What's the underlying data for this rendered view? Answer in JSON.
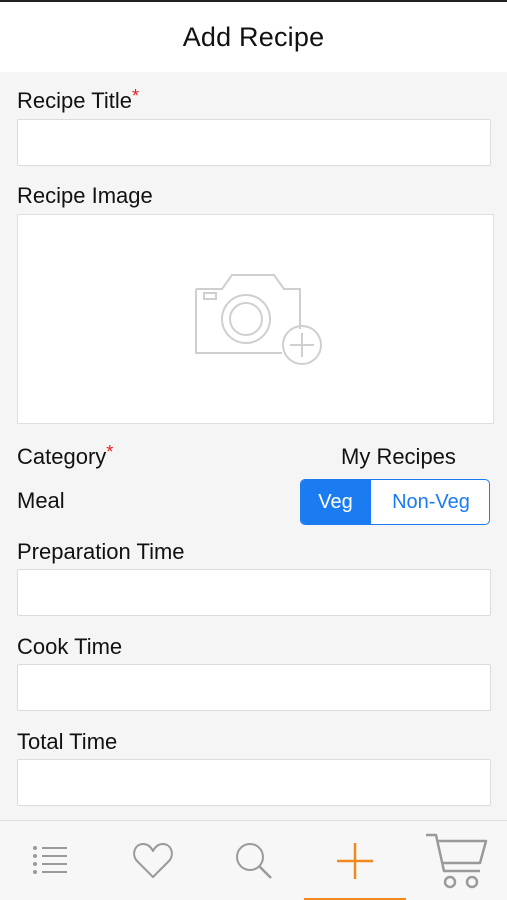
{
  "navbar": {
    "title": "Add Recipe"
  },
  "form": {
    "recipe_title": {
      "label": "Recipe Title",
      "required_mark": "*",
      "value": ""
    },
    "recipe_image": {
      "label": "Recipe Image",
      "icon": "add-photo-camera-icon"
    },
    "category": {
      "label": "Category",
      "required_mark": "*",
      "value": "My Recipes"
    },
    "meal": {
      "label": "Meal",
      "options": [
        "Veg",
        "Non-Veg"
      ],
      "selected": "Veg"
    },
    "preparation_time": {
      "label": "Preparation Time",
      "value": ""
    },
    "cook_time": {
      "label": "Cook Time",
      "value": ""
    },
    "total_time": {
      "label": "Total Time",
      "value": ""
    }
  },
  "tabbar": {
    "items": [
      {
        "icon": "list-icon"
      },
      {
        "icon": "heart-icon"
      },
      {
        "icon": "search-icon"
      },
      {
        "icon": "plus-icon",
        "active": true
      },
      {
        "icon": "cart-icon"
      }
    ],
    "active_color": "#f08a1c",
    "inactive_color": "#9a9a9a"
  },
  "colors": {
    "accent": "#1a7cf0",
    "required": "#e02020"
  }
}
